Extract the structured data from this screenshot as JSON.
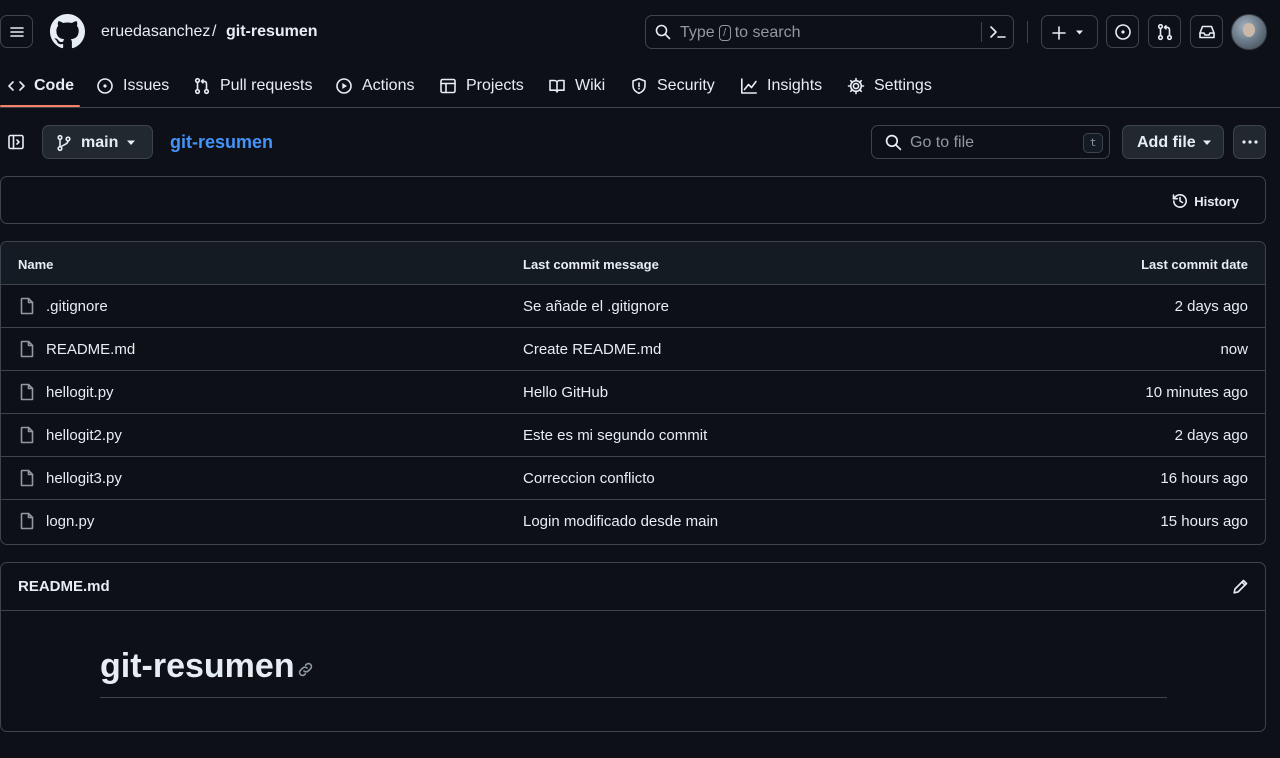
{
  "header": {
    "owner": "eruedasanchez",
    "separator": "/",
    "repo": "git-resumen",
    "search_prefix": "Type",
    "search_key": "/",
    "search_suffix": "to search"
  },
  "nav": {
    "items": [
      {
        "label": "Code",
        "icon": "code-icon"
      },
      {
        "label": "Issues",
        "icon": "issue-icon"
      },
      {
        "label": "Pull requests",
        "icon": "pull-request-icon"
      },
      {
        "label": "Actions",
        "icon": "play-icon"
      },
      {
        "label": "Projects",
        "icon": "table-icon"
      },
      {
        "label": "Wiki",
        "icon": "book-icon"
      },
      {
        "label": "Security",
        "icon": "shield-icon"
      },
      {
        "label": "Insights",
        "icon": "graph-icon"
      },
      {
        "label": "Settings",
        "icon": "gear-icon"
      }
    ]
  },
  "toolbar": {
    "branch": "main",
    "repo_link": "git-resumen",
    "goto_placeholder": "Go to file",
    "goto_key": "t",
    "add_file": "Add file"
  },
  "commit_box": {
    "history": "History"
  },
  "files": {
    "headers": {
      "name": "Name",
      "message": "Last commit message",
      "date": "Last commit date"
    },
    "rows": [
      {
        "name": ".gitignore",
        "message": "Se añade el .gitignore",
        "date": "2 days ago"
      },
      {
        "name": "README.md",
        "message": "Create README.md",
        "date": "now"
      },
      {
        "name": "hellogit.py",
        "message": "Hello GitHub",
        "date": "10 minutes ago"
      },
      {
        "name": "hellogit2.py",
        "message": "Este es mi segundo commit",
        "date": "2 days ago"
      },
      {
        "name": "hellogit3.py",
        "message": "Correccion conflicto",
        "date": "16 hours ago"
      },
      {
        "name": "logn.py",
        "message": "Login modificado desde main",
        "date": "15 hours ago"
      }
    ]
  },
  "readme": {
    "title": "README.md",
    "heading": "git-resumen"
  },
  "colors": {
    "background": "#0d1117",
    "border": "#3d444d",
    "link": "#4493f8",
    "active_tab": "#f78166"
  }
}
